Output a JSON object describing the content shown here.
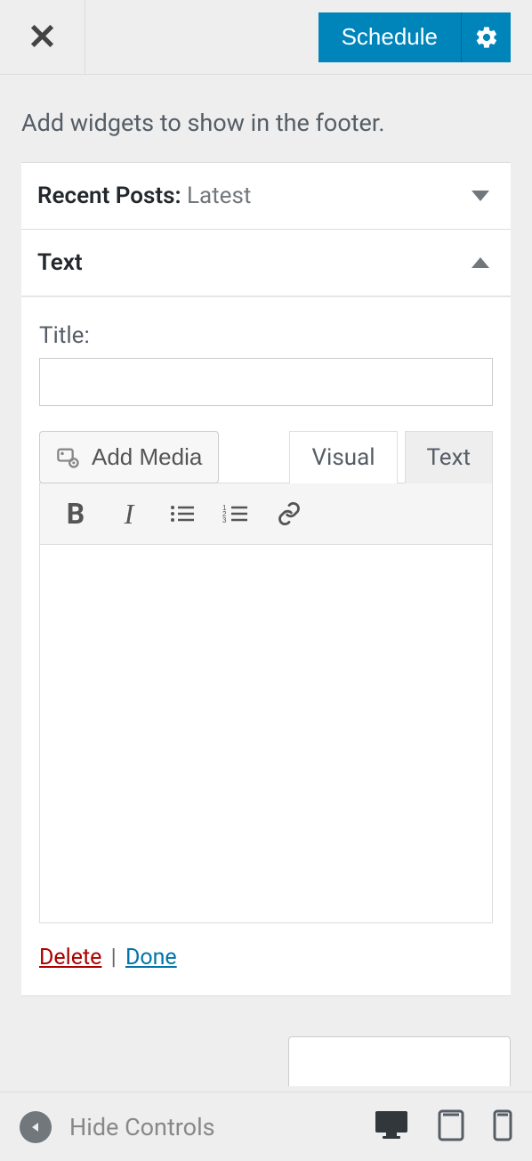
{
  "topbar": {
    "schedule_label": "Schedule"
  },
  "description": "Add widgets to show in the footer.",
  "widgets": {
    "recent_posts": {
      "title": "Recent Posts:",
      "subtitle": " Latest"
    },
    "text": {
      "title": "Text",
      "body": {
        "title_label": "Title:",
        "title_value": "",
        "add_media_label": "Add Media",
        "tabs": {
          "visual": "Visual",
          "text": "Text"
        },
        "editor_content": ""
      },
      "actions": {
        "delete": "Delete",
        "done": "Done",
        "separator": " | "
      }
    }
  },
  "footer": {
    "hide_controls": "Hide Controls"
  }
}
